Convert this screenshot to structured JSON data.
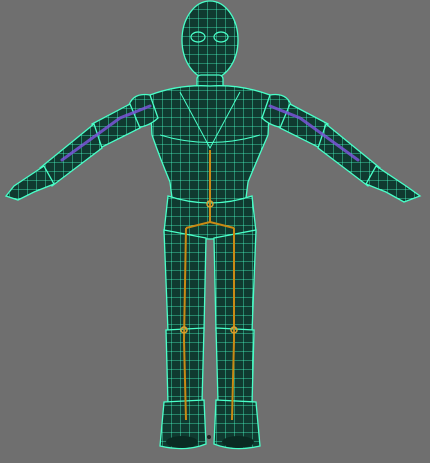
{
  "viewport": {
    "background": "#6f6f6f",
    "wireframe_color": "#49ffc8",
    "skeleton_color": "#c98a14",
    "arm_bone_color": "#7a55d8"
  },
  "scene": {
    "object": "character-mesh",
    "pose": "T-pose"
  }
}
